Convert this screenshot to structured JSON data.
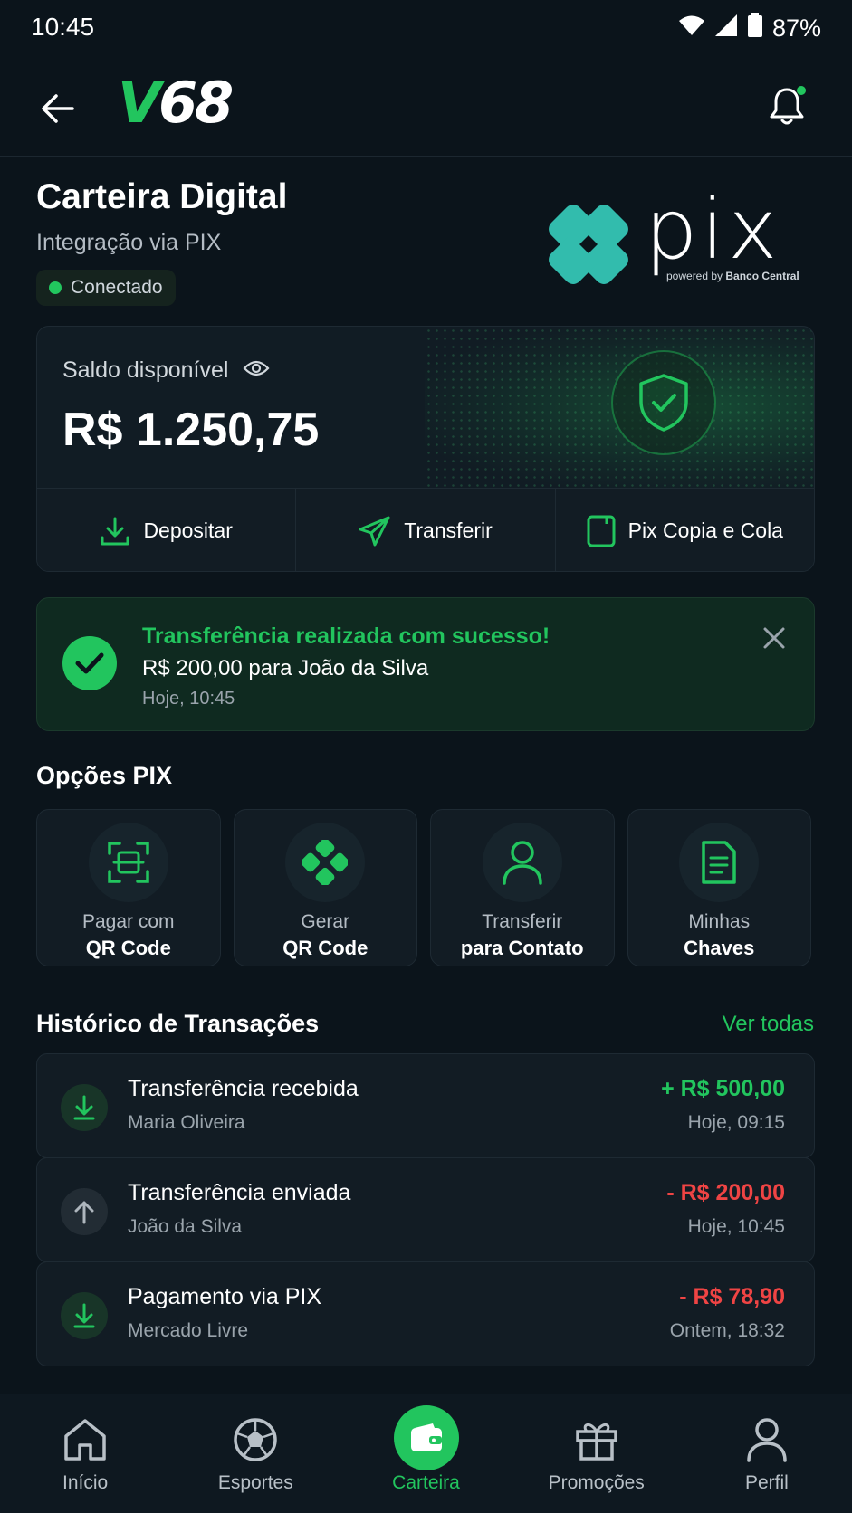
{
  "status_bar": {
    "time": "10:45",
    "battery": "87%"
  },
  "header": {
    "logo_v": "V",
    "logo_rest": "68"
  },
  "wallet": {
    "title": "Carteira Digital",
    "subtitle": "Integração via PIX",
    "status": "Conectado"
  },
  "pix_logo": {
    "wordmark": "pix",
    "tagline_prefix": "powered by",
    "tagline_bold": "Banco Central"
  },
  "balance": {
    "label": "Saldo disponível",
    "value": "R$ 1.250,75",
    "actions": [
      {
        "label": "Depositar"
      },
      {
        "label": "Transferir"
      },
      {
        "label": "Pix Copia e Cola"
      }
    ]
  },
  "toast": {
    "title": "Transferência realizada com sucesso!",
    "message": "R$ 200,00 para João da Silva",
    "time": "Hoje, 10:45"
  },
  "options": {
    "title": "Opções PIX",
    "items": [
      {
        "line1": "Pagar com",
        "line2": "QR Code",
        "icon": "qr-scan-icon"
      },
      {
        "line1": "Gerar",
        "line2": "QR Code",
        "icon": "pix-diamond-icon"
      },
      {
        "line1": "Transferir",
        "line2": "para Contato",
        "icon": "user-icon"
      },
      {
        "line1": "Minhas",
        "line2": "Chaves",
        "icon": "document-icon"
      }
    ]
  },
  "history": {
    "title": "Histórico de Transações",
    "see_all": "Ver todas",
    "items": [
      {
        "name": "Transferência recebida",
        "party": "Maria Oliveira",
        "amount": "+ R$ 500,00",
        "date": "Hoje, 09:15",
        "direction": "in"
      },
      {
        "name": "Transferência enviada",
        "party": "João da Silva",
        "amount": "- R$ 200,00",
        "date": "Hoje, 10:45",
        "direction": "out"
      },
      {
        "name": "Pagamento via PIX",
        "party": "Mercado Livre",
        "amount": "- R$ 78,90",
        "date": "Ontem, 18:32",
        "direction": "in"
      }
    ]
  },
  "nav": {
    "items": [
      {
        "label": "Início"
      },
      {
        "label": "Esportes"
      },
      {
        "label": "Carteira"
      },
      {
        "label": "Promoções"
      },
      {
        "label": "Perfil"
      }
    ],
    "active": "Carteira"
  },
  "colors": {
    "accent": "#22c55e",
    "negative": "#ef4444",
    "background": "#0b141b"
  }
}
